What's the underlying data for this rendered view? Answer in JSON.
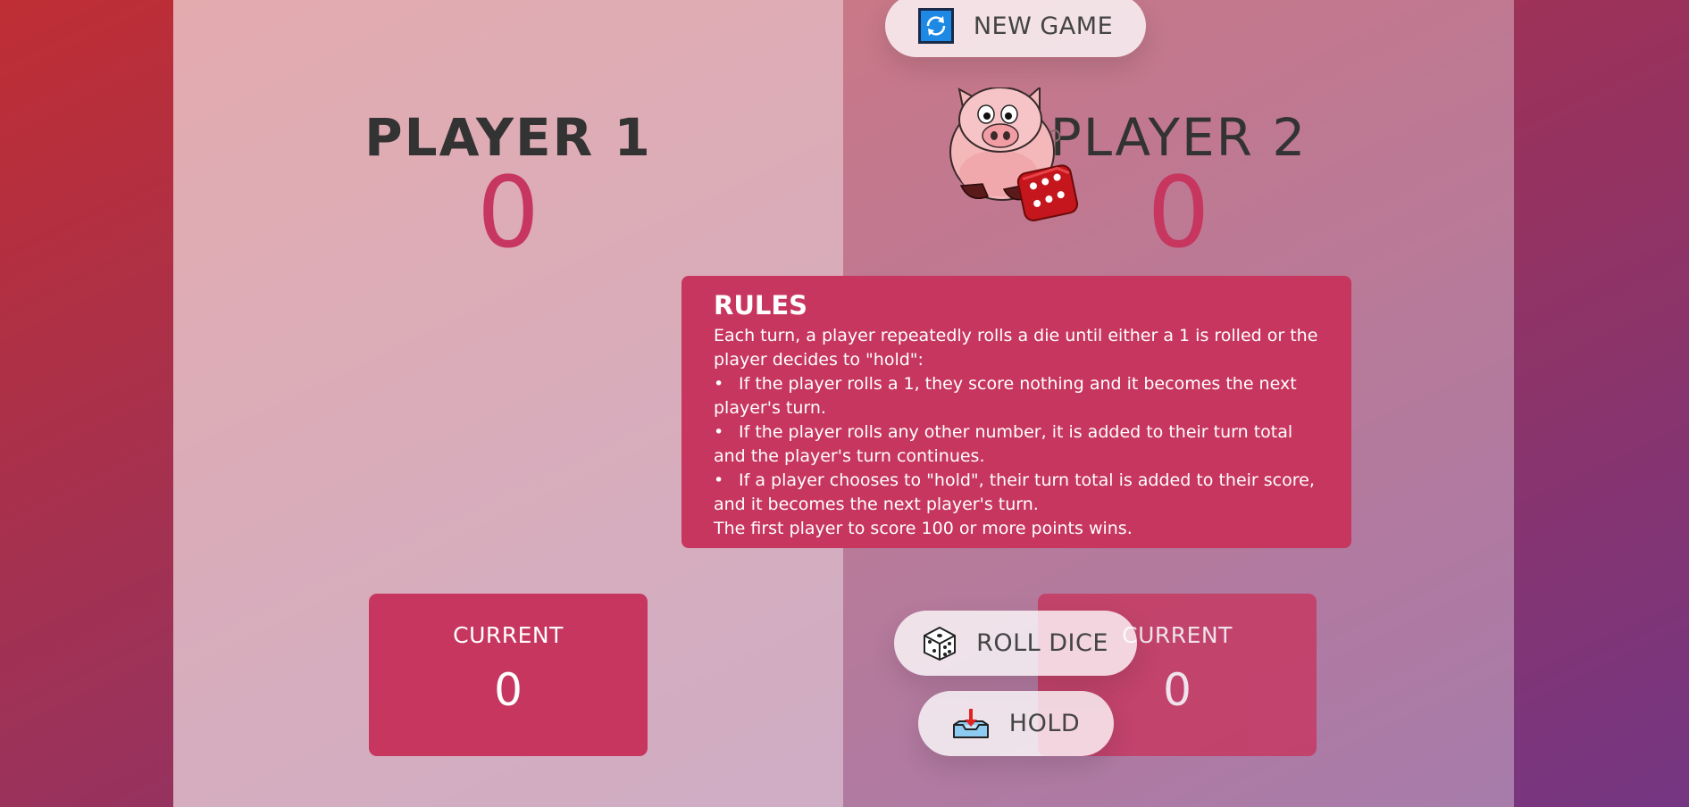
{
  "buttons": {
    "new_game": "NEW GAME",
    "roll_dice": "ROLL DICE",
    "hold": "HOLD"
  },
  "players": [
    {
      "name": "PLAYER 1",
      "score": "0",
      "current_label": "CURRENT",
      "current_score": "0",
      "active": true
    },
    {
      "name": "PLAYER 2",
      "score": "0",
      "current_label": "CURRENT",
      "current_score": "0",
      "active": false
    }
  ],
  "rules": {
    "title": "RULES",
    "intro": "Each turn, a player repeatedly rolls a die until either a 1 is rolled or the player decides to \"hold\":",
    "items": [
      "If the player rolls a 1, they score nothing and it becomes the next player's turn.",
      "If the player rolls any other number, it is added to their turn total and the player's turn continues.",
      "If a player chooses to \"hold\", their turn total is added to their score, and it becomes the next player's turn."
    ],
    "outro": "The first player to score 100 or more points wins."
  },
  "icons": {
    "new_game": "refresh-icon",
    "roll_dice": "dice-icon",
    "hold": "inbox-tray-icon",
    "logo": "pig-with-dice-logo"
  },
  "colors": {
    "accent": "#c7365f",
    "bg_start": "#bf2e34",
    "bg_end": "#753682",
    "text": "#333333"
  }
}
